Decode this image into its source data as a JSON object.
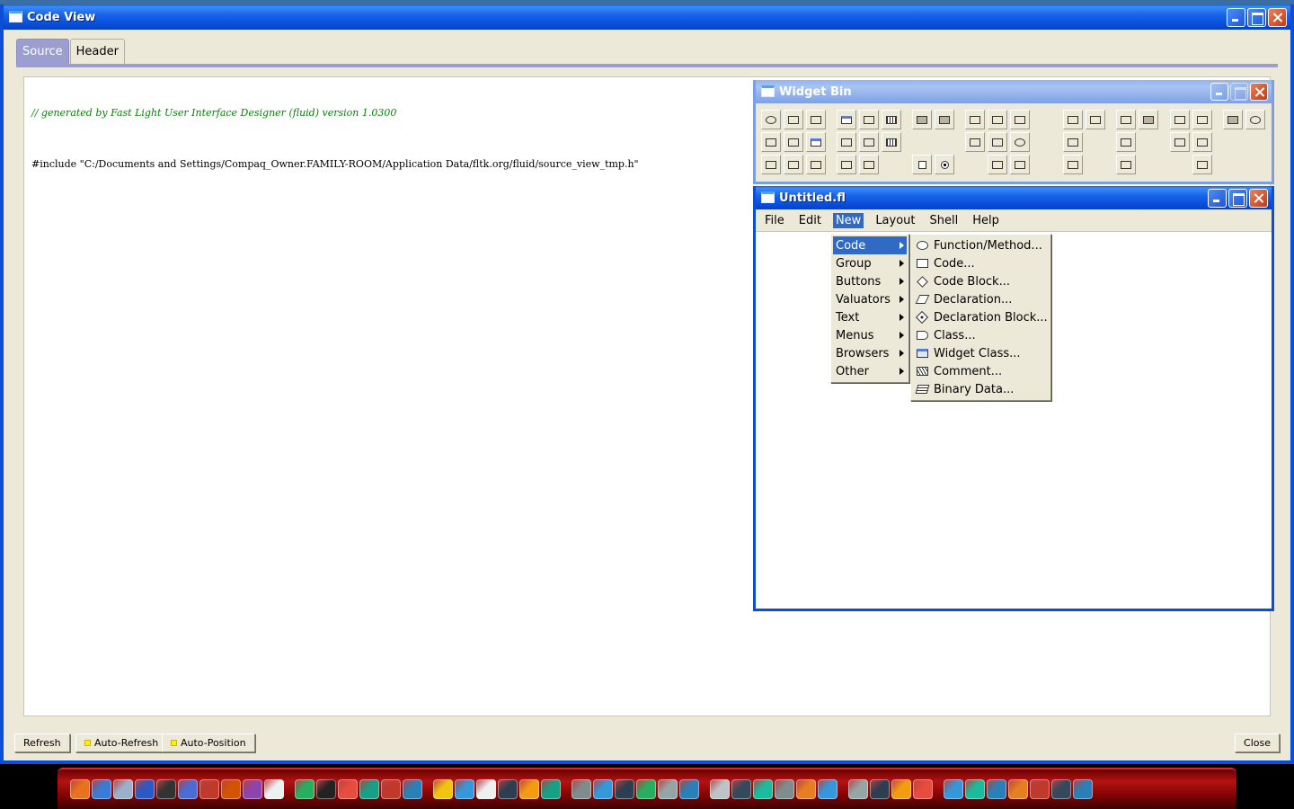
{
  "code_view": {
    "title": "Code View",
    "tabs": [
      {
        "label": "Source",
        "active": true
      },
      {
        "label": "Header",
        "active": false
      }
    ],
    "source_lines": {
      "comment": "// generated by Fast Light User Interface Designer (fluid) version 1.0300",
      "include": "#include \"C:/Documents and Settings/Compaq_Owner.FAMILY-ROOM/Application Data/fltk.org/fluid/source_view_tmp.h\""
    },
    "buttons": {
      "refresh": "Refresh",
      "auto_refresh": "Auto-Refresh",
      "auto_position": "Auto-Position",
      "close": "Close"
    }
  },
  "widget_bin": {
    "title": "Widget Bin"
  },
  "untitled": {
    "title": "Untitled.fl",
    "menubar": [
      {
        "label": "File",
        "active": false
      },
      {
        "label": "Edit",
        "active": false
      },
      {
        "label": "New",
        "active": true
      },
      {
        "label": "Layout",
        "active": false
      },
      {
        "label": "Shell",
        "active": false
      },
      {
        "label": "Help",
        "active": false
      }
    ],
    "new_menu": [
      {
        "label": "Code",
        "active": true
      },
      {
        "label": "Group",
        "active": false
      },
      {
        "label": "Buttons",
        "active": false
      },
      {
        "label": "Valuators",
        "active": false
      },
      {
        "label": "Text",
        "active": false
      },
      {
        "label": "Menus",
        "active": false
      },
      {
        "label": "Browsers",
        "active": false
      },
      {
        "label": "Other",
        "active": false
      }
    ],
    "code_submenu": [
      {
        "label": "Function/Method...",
        "icon": "function-icon"
      },
      {
        "label": "Code...",
        "icon": "code-icon"
      },
      {
        "label": "Code Block...",
        "icon": "code-block-icon"
      },
      {
        "label": "Declaration...",
        "icon": "declaration-icon"
      },
      {
        "label": "Declaration Block...",
        "icon": "declaration-block-icon"
      },
      {
        "label": "Class...",
        "icon": "class-icon"
      },
      {
        "label": "Widget Class...",
        "icon": "widget-class-icon"
      },
      {
        "label": "Comment...",
        "icon": "comment-icon"
      },
      {
        "label": "Binary Data...",
        "icon": "binary-data-icon"
      }
    ]
  },
  "colors": {
    "title_blue": "#0a4fd6",
    "menu_highlight": "#316ac5",
    "tab_active": "#9c9ed0",
    "comment_green": "#008800",
    "auto_led": "#ffef00"
  }
}
